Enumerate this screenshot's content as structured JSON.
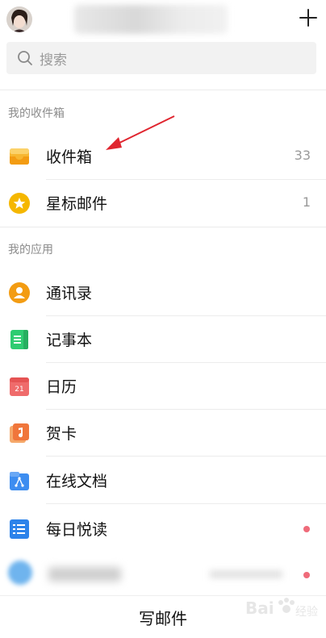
{
  "header": {
    "add_icon": "plus-icon"
  },
  "search": {
    "placeholder": "搜索",
    "icon": "search-icon"
  },
  "sections": [
    {
      "title": "我的收件箱",
      "items": [
        {
          "label": "收件箱",
          "count": "33",
          "icon": "inbox-icon"
        },
        {
          "label": "星标邮件",
          "count": "1",
          "icon": "star-icon"
        }
      ]
    },
    {
      "title": "我的应用",
      "items": [
        {
          "label": "通讯录",
          "icon": "contacts-icon"
        },
        {
          "label": "记事本",
          "icon": "notepad-icon"
        },
        {
          "label": "日历",
          "icon": "calendar-icon",
          "icon_text": "21"
        },
        {
          "label": "贺卡",
          "icon": "card-icon"
        },
        {
          "label": "在线文档",
          "icon": "docs-icon"
        },
        {
          "label": "每日悦读",
          "icon": "reading-icon",
          "badge": "red-dot"
        }
      ]
    }
  ],
  "footer": {
    "compose_label": "写邮件"
  },
  "watermark": {
    "text": "Bai 经验"
  },
  "colors": {
    "accent_red": "#ef6b7a",
    "annotation_red": "#e0252f"
  }
}
